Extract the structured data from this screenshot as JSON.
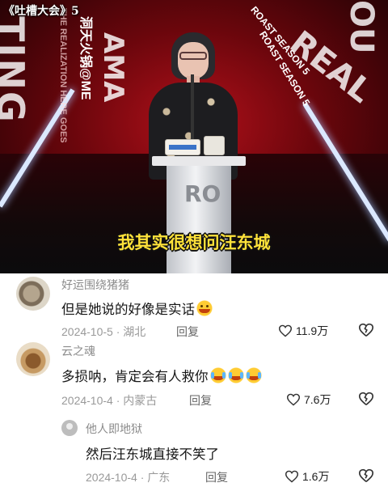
{
  "video": {
    "show_title": "《吐槽大会》5",
    "subtitle": "我其实很想问汪东城",
    "backdrop": {
      "word_left": "TING",
      "word_center": "AMA",
      "word_right": "REAL",
      "word_far_right": "OU",
      "small_left": "THE REALIZATION HERE GOES",
      "small_center": "洞天火锅@ME",
      "small_right_1": "ROAST SEASON 5",
      "small_right_2": "ROAST SEASON 5"
    },
    "podium_logo": "RO"
  },
  "comments": [
    {
      "username": "好运围绕猪猪",
      "text": "但是她说的好像是实话",
      "emoji": "grinning-sweat-emoji",
      "date": "2024-10-5",
      "location": "湖北",
      "reply_label": "回复",
      "likes": "11.9万"
    },
    {
      "username": "云之魂",
      "text": "多损呐，肯定会有人救你",
      "emoji_count": 3,
      "emoji": "crying-laughing-emoji",
      "date": "2024-10-4",
      "location": "内蒙古",
      "reply_label": "回复",
      "likes": "7.6万"
    },
    {
      "username": "他人即地狱",
      "text": "然后汪东城直接不笑了",
      "date": "2024-10-4",
      "location": "广东",
      "reply_label": "回复",
      "likes": "1.6万"
    }
  ],
  "icons": {
    "like": "heart-outline-icon",
    "dislike": "broken-heart-icon"
  },
  "colors": {
    "subtitle": "#ffe23a",
    "stage_red": "#b0101a",
    "meta_gray": "#999999",
    "text": "#161616"
  }
}
